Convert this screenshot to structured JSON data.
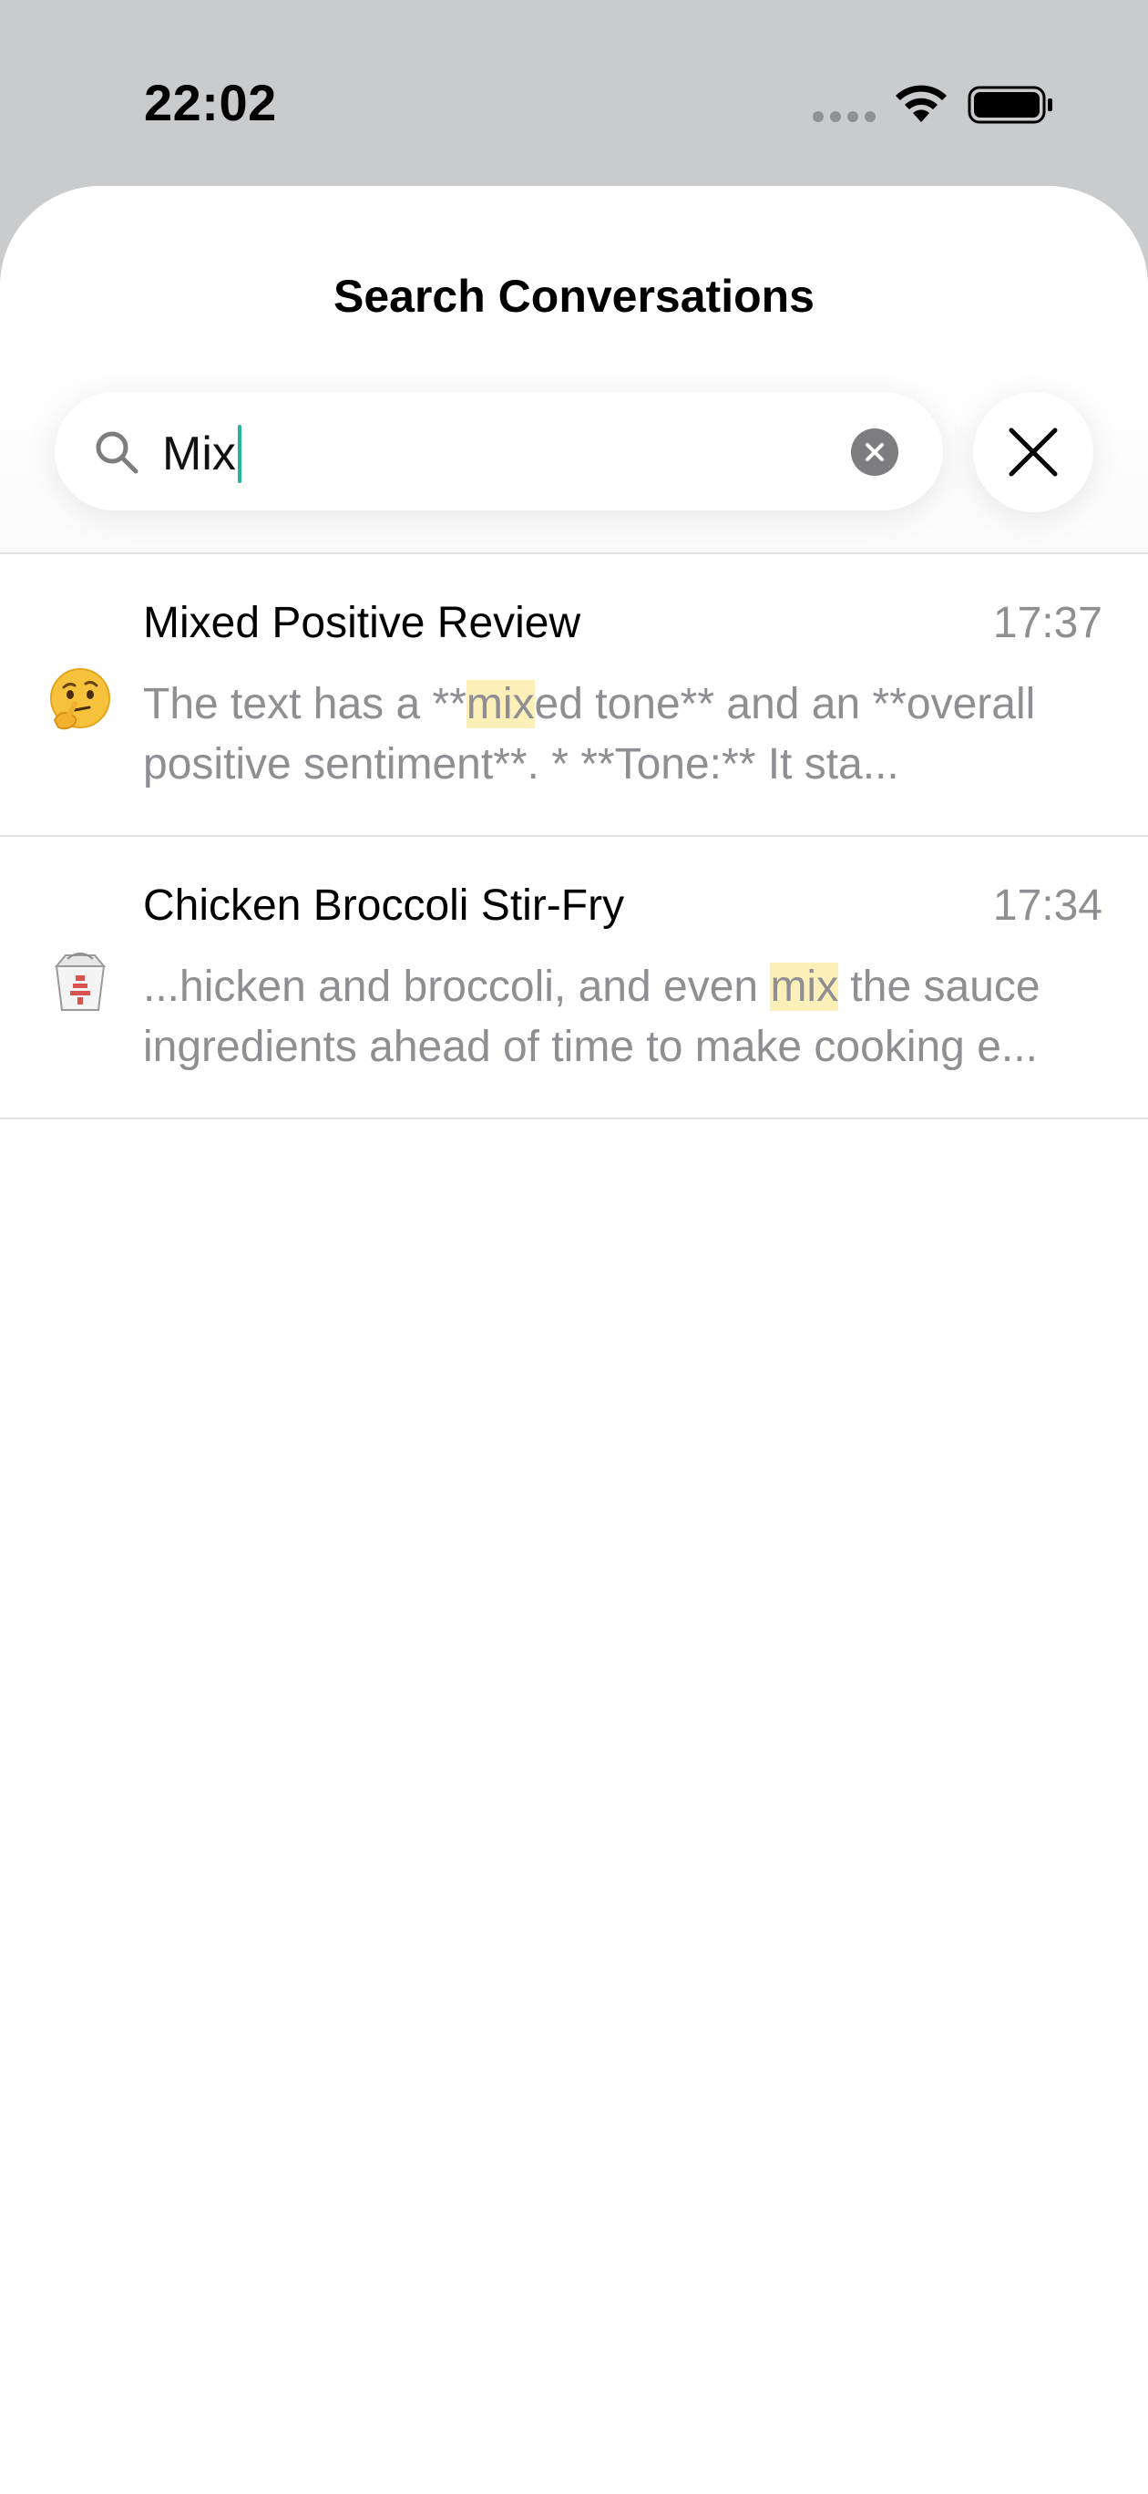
{
  "status_bar": {
    "time": "22:02"
  },
  "sheet": {
    "title": "Search Conversations"
  },
  "search": {
    "value": "Mix"
  },
  "results": [
    {
      "title": "Mixed Positive Review",
      "time": "17:37",
      "emoji_icon": "thinking-face-icon",
      "snippet_line1_pre": "The text has a **",
      "snippet_line1_match": "mix",
      "snippet_line1_post": "ed tone** and an **overall",
      "snippet_line2": "positive sentiment**.  *   **Tone:** It sta..."
    },
    {
      "title": "Chicken Broccoli Stir-Fry",
      "time": "17:34",
      "emoji_icon": "takeout-box-icon",
      "snippet_line1_pre": "...hicken and broccoli, and even ",
      "snippet_line1_match": "mix",
      "snippet_line1_post": " the sauce",
      "snippet_line2": "ingredients ahead of time to make cooking e..."
    }
  ],
  "colors": {
    "accent_caret": "#25b39b",
    "highlight": "#fdefb8",
    "secondary_text": "#8e8e93"
  }
}
